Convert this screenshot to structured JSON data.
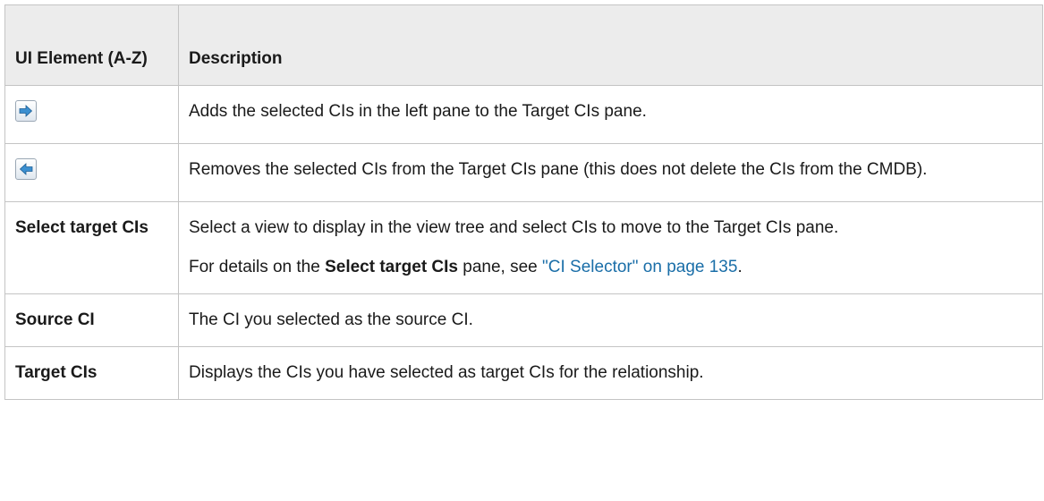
{
  "table": {
    "header": {
      "element": "UI Element (A-Z)",
      "description": "Description"
    },
    "rows": [
      {
        "icon": "add-right-arrow-icon",
        "description": "Adds the selected CIs in the left pane to the Target CIs pane."
      },
      {
        "icon": "remove-left-arrow-icon",
        "description": "Removes the selected CIs from the Target CIs pane (this does not delete the CIs from the CMDB)."
      },
      {
        "name": "Select target CIs",
        "description": "Select a view to display in the view tree and select CIs to move to the Target CIs pane.",
        "details": {
          "prefix": "For details on the ",
          "strong": "Select target CIs",
          "middle": " pane, see ",
          "link": "\"CI Selector\" on page 135",
          "suffix": "."
        }
      },
      {
        "name": "Source CI",
        "description": "The CI you selected as the source CI."
      },
      {
        "name": "Target CIs",
        "description": "Displays the CIs you have selected as target CIs for the relationship."
      }
    ]
  },
  "colors": {
    "header_bg": "#ececec",
    "border": "#c4c4c4",
    "link": "#1a6ea8",
    "arrow": "#3b8fd0"
  }
}
